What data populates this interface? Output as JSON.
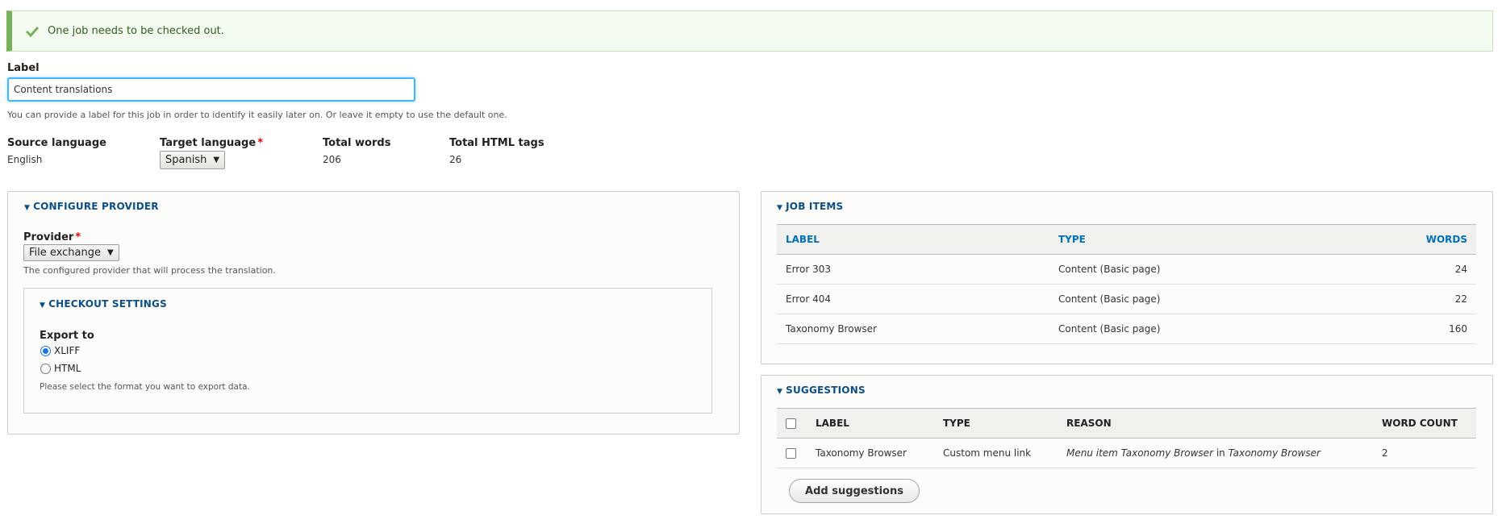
{
  "status": {
    "message": "One job needs to be checked out."
  },
  "label_field": {
    "label": "Label",
    "value": "Content translations",
    "description": "You can provide a label for this job in order to identify it easily later on. Or leave it empty to use the default one."
  },
  "job_info": {
    "source_language_label": "Source language",
    "source_language": "English",
    "target_language_label": "Target language",
    "target_language": "Spanish",
    "total_words_label": "Total words",
    "total_words": "206",
    "total_html_tags_label": "Total HTML tags",
    "total_html_tags": "26"
  },
  "configure_provider": {
    "title": "CONFIGURE PROVIDER",
    "provider_label": "Provider",
    "provider_value": "File exchange",
    "provider_description": "The configured provider that will process the translation.",
    "checkout_settings": {
      "title": "CHECKOUT SETTINGS",
      "export_label": "Export to",
      "options": [
        "XLIFF",
        "HTML"
      ],
      "selected": "XLIFF",
      "description": "Please select the format you want to export data."
    }
  },
  "job_items": {
    "title": "JOB ITEMS",
    "headers": {
      "label": "LABEL",
      "type": "TYPE",
      "words": "WORDS"
    },
    "rows": [
      {
        "label": "Error 303",
        "type": "Content (Basic page)",
        "words": "24"
      },
      {
        "label": "Error 404",
        "type": "Content (Basic page)",
        "words": "22"
      },
      {
        "label": "Taxonomy Browser",
        "type": "Content (Basic page)",
        "words": "160"
      }
    ]
  },
  "suggestions": {
    "title": "SUGGESTIONS",
    "headers": {
      "label": "LABEL",
      "type": "TYPE",
      "reason": "REASON",
      "word_count": "WORD COUNT"
    },
    "rows": [
      {
        "label": "Taxonomy Browser",
        "type": "Custom menu link",
        "reason_a": "Menu item Taxonomy Browser",
        "reason_in": " in ",
        "reason_b": "Taxonomy Browser",
        "word_count": "2"
      }
    ],
    "add_button": "Add suggestions"
  },
  "colors": {
    "accent": "#0b4f86",
    "link": "#0071b8",
    "status_green": "#77b259"
  }
}
